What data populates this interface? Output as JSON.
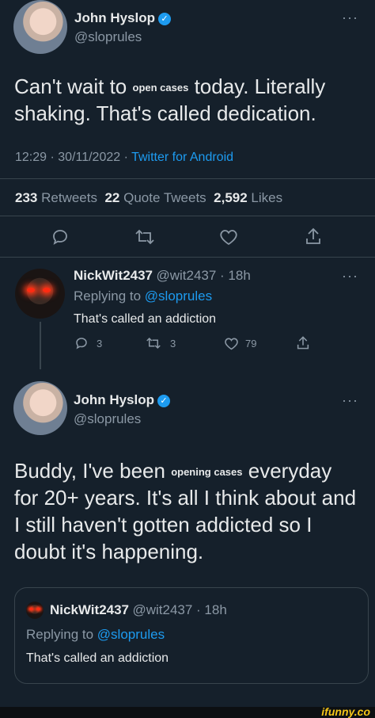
{
  "tweet": {
    "author_name": "John Hyslop",
    "author_handle": "@sloprules",
    "text_part1": "Can't wait to",
    "text_small": "open cases",
    "text_part2": "today. Literally",
    "text_line2": "shaking. That's called dedication.",
    "timestamp": "12:29 · 30/11/2022 ·",
    "source": "Twitter for Android",
    "retweets_count": "233",
    "retweets_label": "Retweets",
    "quote_count": "22",
    "quote_label": "Quote Tweets",
    "likes_count": "2,592",
    "likes_label": "Likes",
    "more": "···"
  },
  "reply": {
    "author_name": "NickWit2437",
    "author_handle": "@wit2437 · 18h",
    "replying_label": "Replying to",
    "replying_handle": "@sloprules",
    "text": "That's called an addiction",
    "reply_count": "3",
    "retweet_count": "3",
    "like_count": "79",
    "more": "···"
  },
  "second": {
    "author_name": "John Hyslop",
    "author_handle": "@sloprules",
    "line1_a": "Buddy, I've been",
    "line1_small": "opening cases",
    "line1_b": "everyday",
    "line2": "for 20+ years. It's all I think about and",
    "line3": "I still haven't gotten addicted so I",
    "line4": "doubt it's happening.",
    "more": "···"
  },
  "quoted": {
    "author_name": "NickWit2437",
    "author_handle": "@wit2437 · 18h",
    "replying_label": "Replying to",
    "replying_handle": "@sloprules",
    "text": "That's called an addiction"
  },
  "watermark": "ifunny.co",
  "colors": {
    "background": "#15202b",
    "text": "#e7e9ea",
    "muted": "#8b98a5",
    "link": "#1d9bf0",
    "divider": "#38444d",
    "verified": "#1d9bf0"
  },
  "icons": [
    "reply-icon",
    "retweet-icon",
    "like-icon",
    "share-icon",
    "verified-badge-icon",
    "more-icon"
  ]
}
